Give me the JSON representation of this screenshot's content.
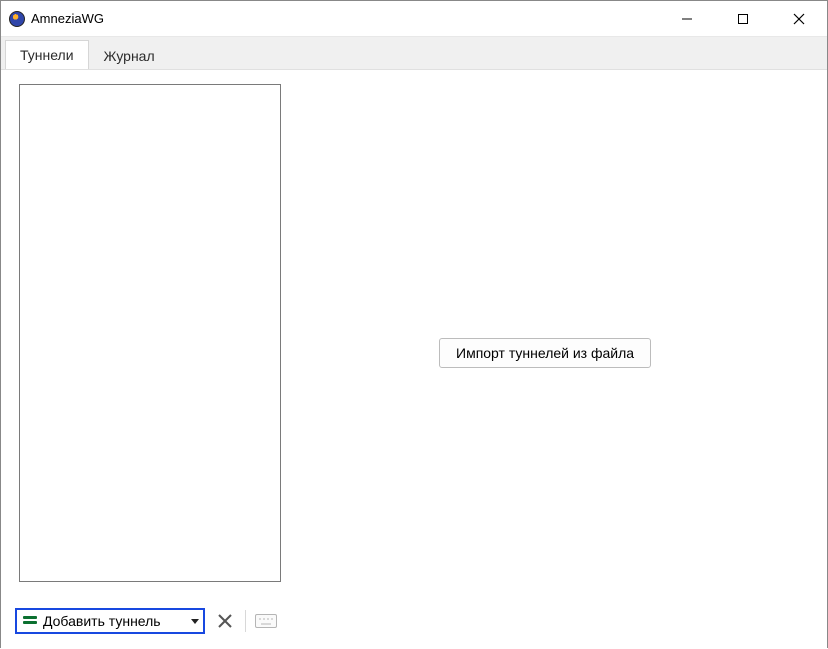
{
  "window": {
    "title": "AmneziaWG"
  },
  "tabs": {
    "tunnels": "Туннели",
    "log": "Журнал"
  },
  "buttons": {
    "import_from_file": "Импорт туннелей из файла",
    "add_tunnel": "Добавить туннель"
  }
}
